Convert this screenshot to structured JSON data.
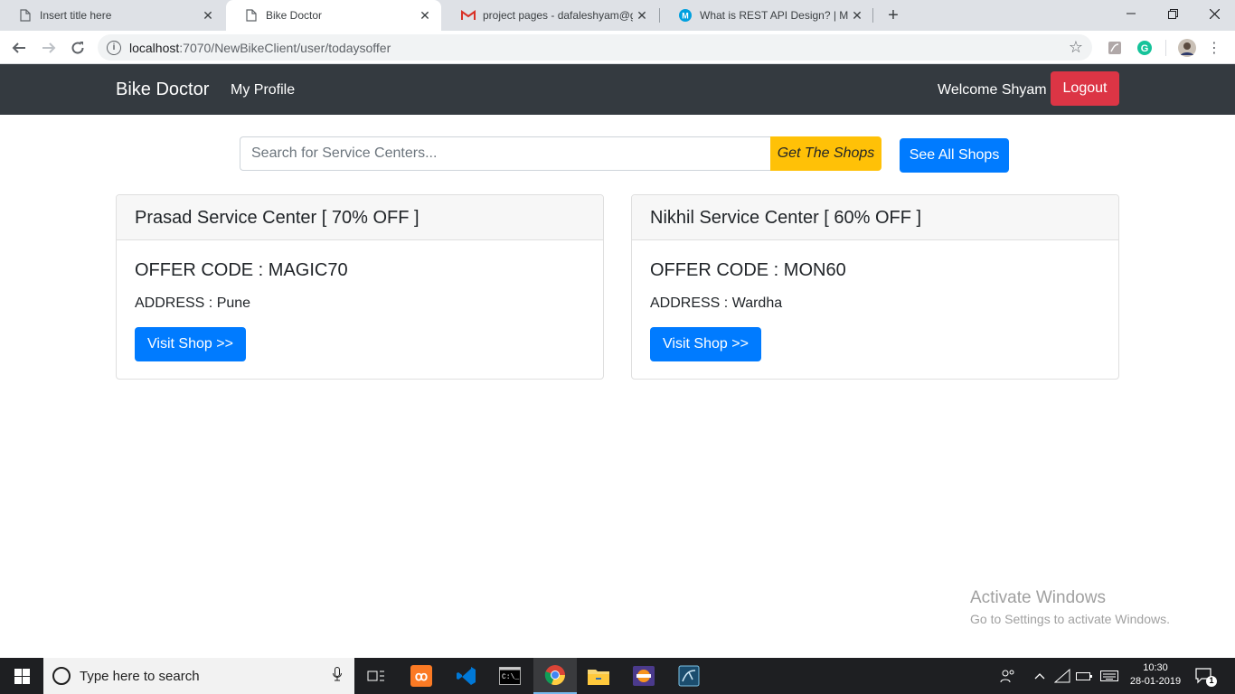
{
  "browser": {
    "tabs": [
      {
        "title": "Insert title here",
        "active": false,
        "icon": "page-icon"
      },
      {
        "title": "Bike Doctor",
        "active": true,
        "icon": "page-icon"
      },
      {
        "title": "project pages - dafaleshyam@gm",
        "active": false,
        "icon": "gmail-icon"
      },
      {
        "title": "What is REST API Design? | MuleS",
        "active": false,
        "icon": "mulesoft-icon"
      }
    ],
    "url_host": "localhost",
    "url_path": ":7070/NewBikeClient/user/todaysoffer"
  },
  "navbar": {
    "brand": "Bike Doctor",
    "my_profile": "My Profile",
    "welcome": "Welcome Shyam",
    "logout": "Logout"
  },
  "search": {
    "placeholder": "Search for Service Centers...",
    "value": "",
    "get_shops": "Get The Shops",
    "see_all": "See All Shops"
  },
  "offers": [
    {
      "title": "Prasad Service Center [ 70% OFF ]",
      "code": "OFFER CODE : MAGIC70",
      "address": "ADDRESS : Pune",
      "button": "Visit Shop >>"
    },
    {
      "title": "Nikhil Service Center [ 60% OFF ]",
      "code": "OFFER CODE : MON60",
      "address": "ADDRESS : Wardha",
      "button": "Visit Shop >>"
    }
  ],
  "watermark": {
    "line1": "Activate Windows",
    "line2": "Go to Settings to activate Windows."
  },
  "taskbar": {
    "search_placeholder": "Type here to search",
    "time": "10:30",
    "date": "28-01-2019",
    "notification_count": "1"
  },
  "colors": {
    "navbar_bg": "#343a40",
    "logout_bg": "#dc3545",
    "primary": "#007bff",
    "warning": "#ffc107"
  }
}
